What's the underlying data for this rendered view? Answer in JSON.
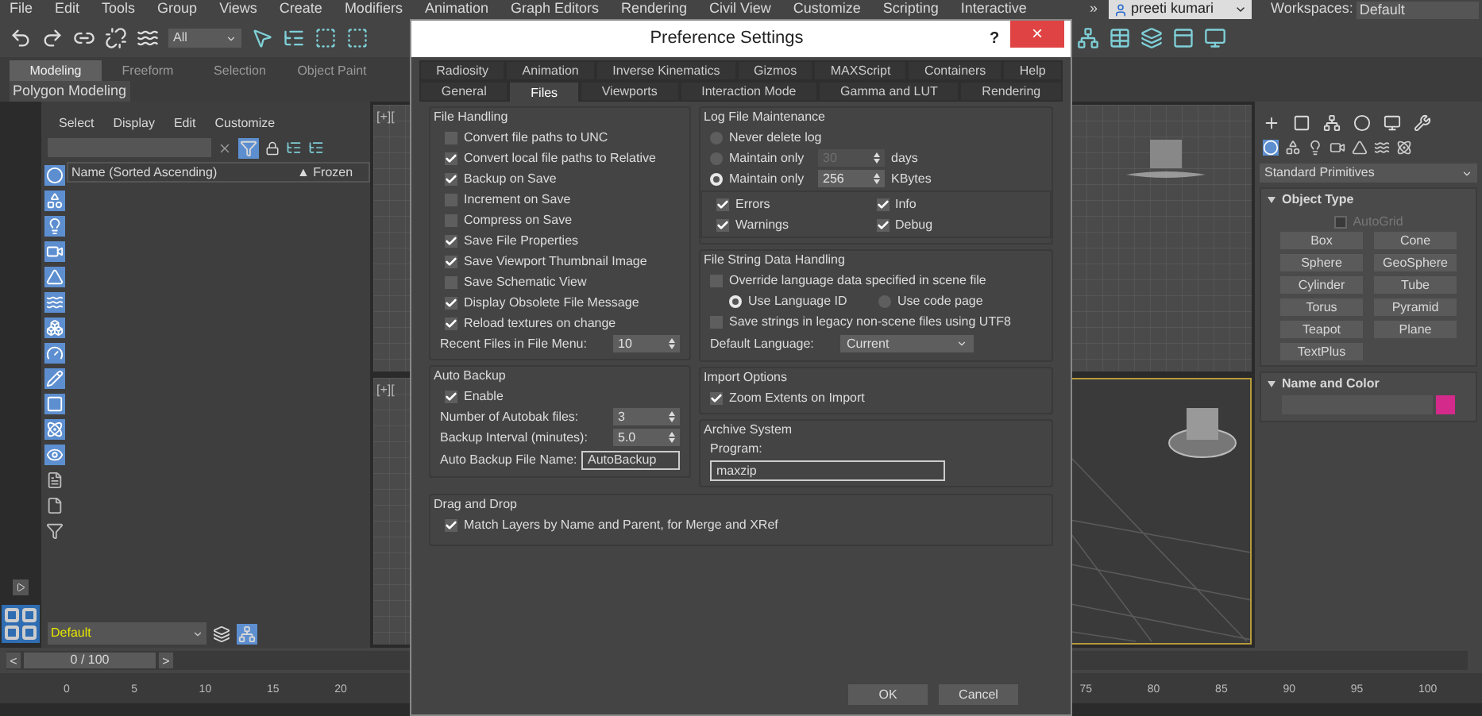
{
  "menu_bar": {
    "items": [
      "File",
      "Edit",
      "Tools",
      "Group",
      "Views",
      "Create",
      "Modifiers",
      "Animation",
      "Graph Editors",
      "Rendering",
      "Civil View",
      "Customize",
      "Scripting",
      "Interactive"
    ],
    "overflow": "»",
    "user": "preeti kumari",
    "workspaces_label": "Workspaces:",
    "workspace": "Default"
  },
  "toolbar": {
    "selection_filter": "All"
  },
  "ribbon": {
    "tabs": [
      {
        "label": "Modeling",
        "selected": true
      },
      {
        "label": "Freeform",
        "selected": false
      },
      {
        "label": "Selection",
        "selected": false
      },
      {
        "label": "Object Paint",
        "selected": false
      }
    ],
    "panel": "Polygon Modeling"
  },
  "scene_explorer": {
    "menu": [
      "Select",
      "Display",
      "Edit",
      "Customize"
    ],
    "columns": [
      "Name (Sorted Ascending)",
      "▲ Frozen"
    ],
    "filters": [
      {
        "on": true
      },
      {
        "on": true
      },
      {
        "on": true
      },
      {
        "on": true
      },
      {
        "on": true
      },
      {
        "on": true
      },
      {
        "on": true
      },
      {
        "on": true
      },
      {
        "on": true
      },
      {
        "on": true
      },
      {
        "on": true
      },
      {
        "on": true
      },
      {
        "on": false
      },
      {
        "on": false
      },
      {
        "on": false
      }
    ],
    "layer": "Default"
  },
  "viewports": {
    "labels": [
      "[+][",
      "[+]["
    ]
  },
  "time_slider": {
    "prev": "<",
    "frame": "0 / 100",
    "next": ">",
    "level": 0
  },
  "track_bar": {
    "ticks": [
      "0",
      "5",
      "10",
      "15",
      "20",
      "75",
      "80",
      "85",
      "90",
      "95",
      "100"
    ]
  },
  "command_panel": {
    "category": "Standard Primitives",
    "object_type": {
      "title": "Object Type",
      "autogrid": {
        "label": "AutoGrid",
        "checked": false,
        "disabled": true
      },
      "buttons": [
        "Box",
        "Cone",
        "Sphere",
        "GeoSphere",
        "Cylinder",
        "Tube",
        "Torus",
        "Pyramid",
        "Teapot",
        "Plane",
        "TextPlus"
      ]
    },
    "name_and_color": {
      "title": "Name and Color",
      "color": "#d42a8c"
    }
  },
  "dialog": {
    "title": "Preference Settings",
    "help": "?",
    "close": "×",
    "tab_rows": [
      [
        {
          "label": "Radiosity",
          "selected": false
        },
        {
          "label": "Animation",
          "selected": false
        },
        {
          "label": "Inverse Kinematics",
          "selected": false
        },
        {
          "label": "Gizmos",
          "selected": false
        },
        {
          "label": "MAXScript",
          "selected": false
        },
        {
          "label": "Containers",
          "selected": false
        },
        {
          "label": "Help",
          "selected": false
        }
      ],
      [
        {
          "label": "General",
          "selected": false
        },
        {
          "label": "Files",
          "selected": true
        },
        {
          "label": "Viewports",
          "selected": false
        },
        {
          "label": "Interaction Mode",
          "selected": false
        },
        {
          "label": "Gamma and LUT",
          "selected": false
        },
        {
          "label": "Rendering",
          "selected": false
        }
      ]
    ],
    "file_handling": {
      "title": "File Handling",
      "options": [
        {
          "label": "Convert file paths to UNC",
          "checked": false
        },
        {
          "label": "Convert local file paths to Relative",
          "checked": true
        },
        {
          "label": "Backup on Save",
          "checked": true
        },
        {
          "label": "Increment on Save",
          "checked": false
        },
        {
          "label": "Compress on Save",
          "checked": false
        },
        {
          "label": "Save File Properties",
          "checked": true
        },
        {
          "label": "Save Viewport Thumbnail Image",
          "checked": true
        },
        {
          "label": "Save Schematic View",
          "checked": false
        },
        {
          "label": "Display Obsolete File Message",
          "checked": true
        },
        {
          "label": "Reload textures on change",
          "checked": true
        }
      ],
      "recent_label": "Recent Files in File Menu:",
      "recent_value": "10"
    },
    "auto_backup": {
      "title": "Auto Backup",
      "enable": {
        "label": "Enable",
        "checked": true
      },
      "spinners": [
        {
          "label": "Number of Autobak files:",
          "value": "3"
        },
        {
          "label": "Backup Interval (minutes):",
          "value": "5.0"
        }
      ],
      "name_label": "Auto Backup File Name:",
      "name_value": "AutoBackup"
    },
    "drag_and_drop": {
      "title": "Drag and Drop",
      "option": {
        "label": "Match Layers by Name and Parent, for Merge and XRef",
        "checked": true
      }
    },
    "log_file": {
      "title": "Log File Maintenance",
      "radios": [
        {
          "label": "Never delete log",
          "selected": false
        },
        {
          "label": "Maintain only",
          "selected": false,
          "value": "30",
          "unit": "days",
          "disabled": true
        },
        {
          "label": "Maintain only",
          "selected": true,
          "value": "256",
          "unit": "KBytes",
          "disabled": false
        }
      ],
      "levels": [
        {
          "label": "Errors",
          "checked": true
        },
        {
          "label": "Info",
          "checked": true
        },
        {
          "label": "Warnings",
          "checked": true
        },
        {
          "label": "Debug",
          "checked": true
        }
      ]
    },
    "file_string": {
      "title": "File String Data Handling",
      "override": {
        "label": "Override language data specified in scene file",
        "checked": false
      },
      "modes": [
        {
          "label": "Use Language ID",
          "selected": true
        },
        {
          "label": "Use code page",
          "selected": false
        }
      ],
      "legacy": {
        "label": "Save strings in legacy non-scene files using UTF8",
        "checked": false
      },
      "language_label": "Default Language:",
      "language": "Current"
    },
    "import_options": {
      "title": "Import Options",
      "option": {
        "label": "Zoom Extents on Import",
        "checked": true
      }
    },
    "archive": {
      "title": "Archive System",
      "label": "Program:",
      "value": "maxzip"
    },
    "buttons": [
      "OK",
      "Cancel"
    ]
  }
}
